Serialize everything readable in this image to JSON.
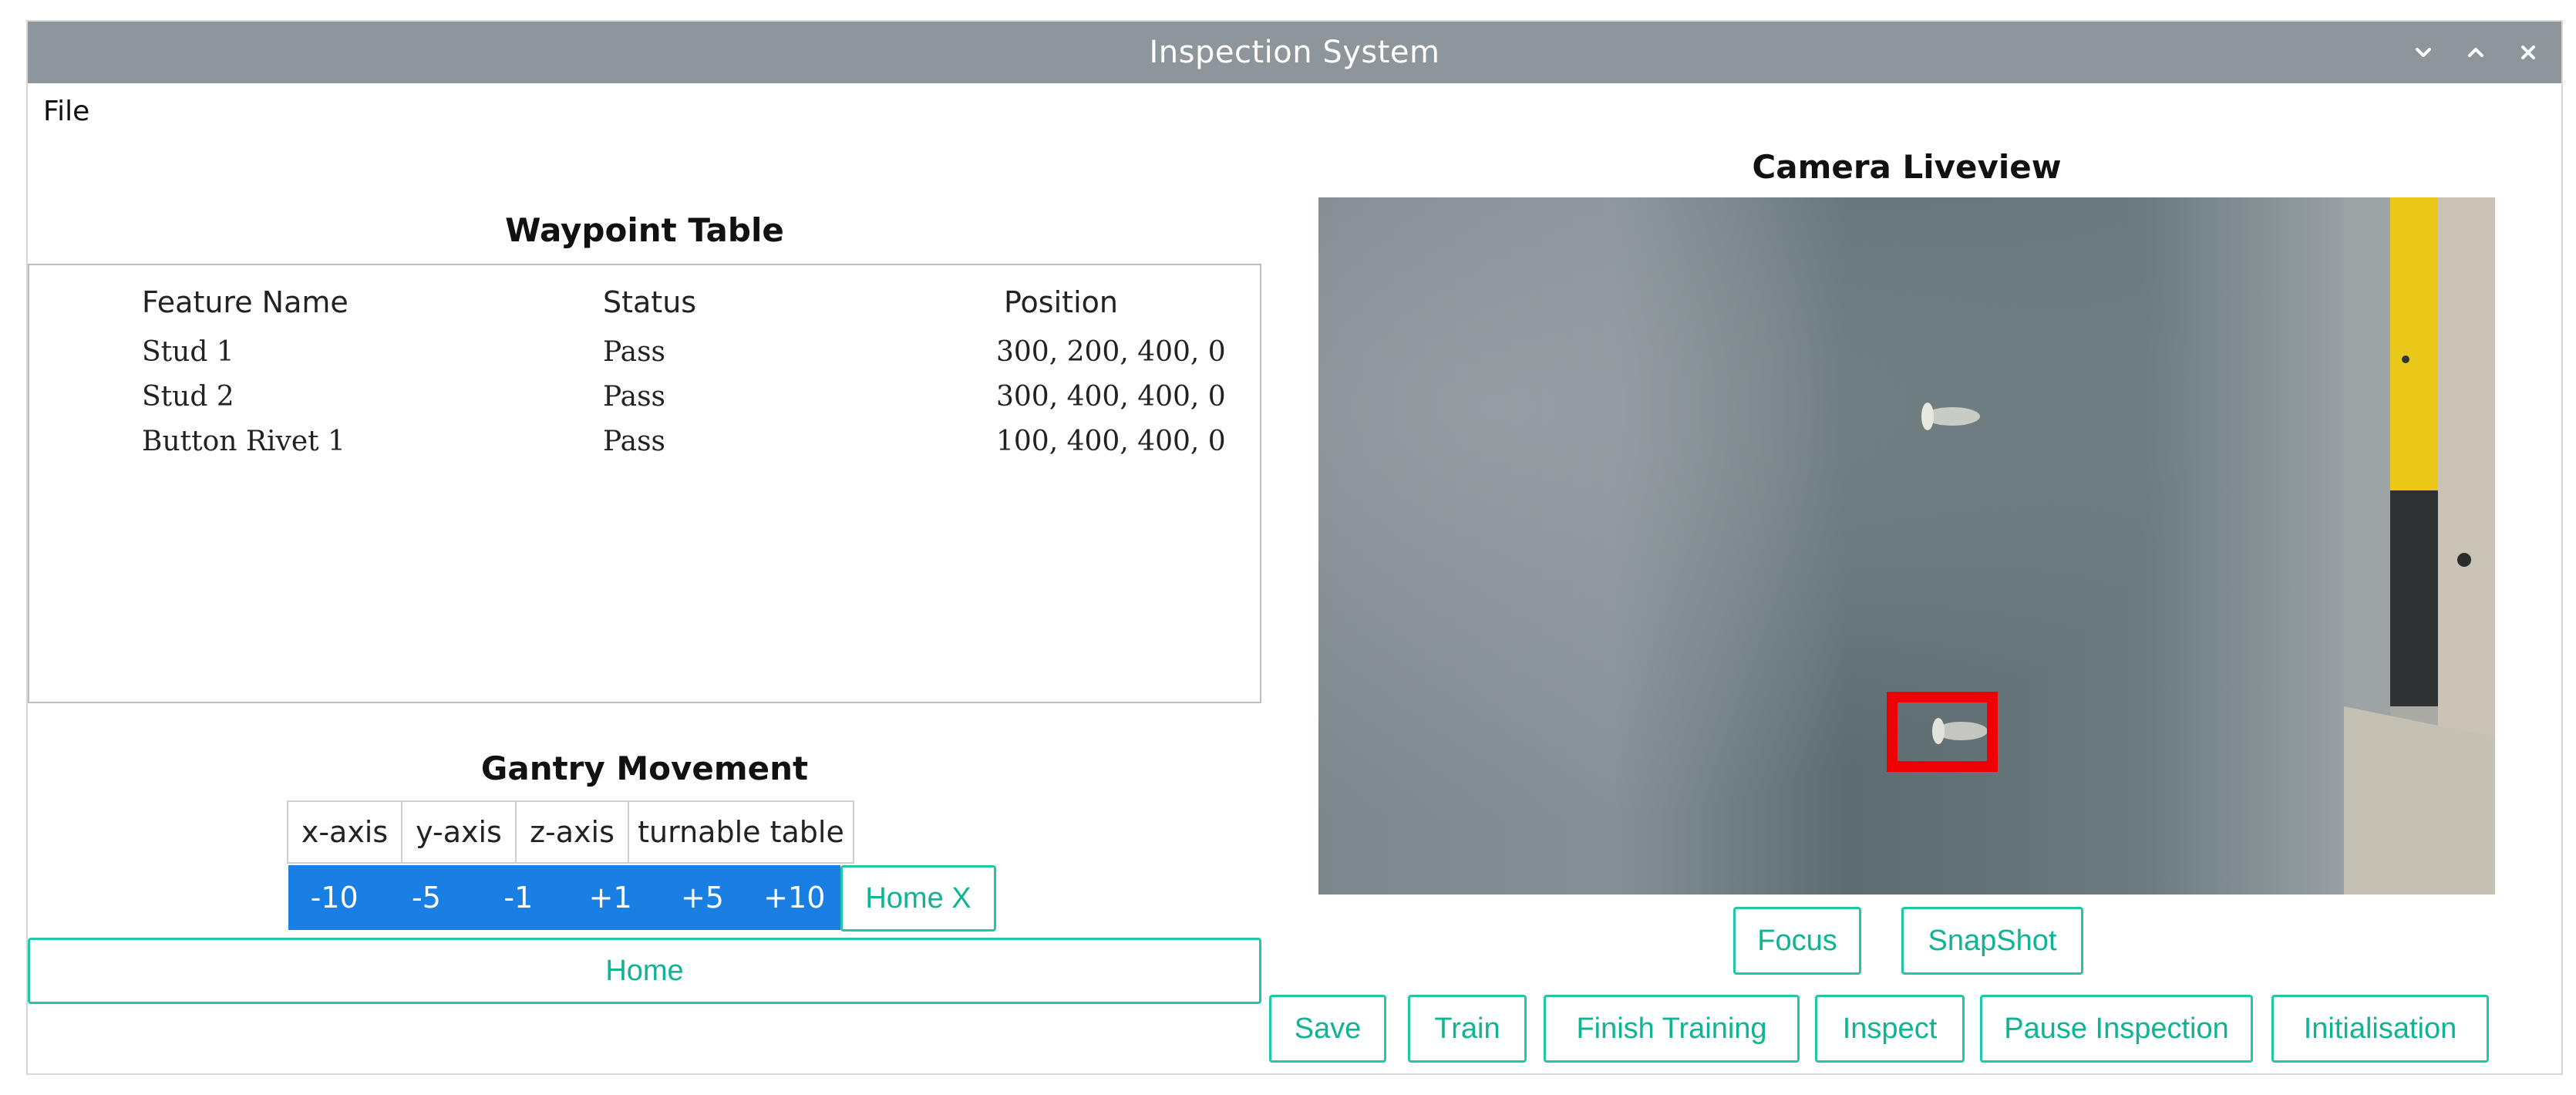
{
  "window": {
    "title": "Inspection System",
    "controls": [
      "minimize-icon",
      "maximize-icon",
      "close-icon"
    ]
  },
  "menu": {
    "file": "File"
  },
  "waypoint_table": {
    "title": "Waypoint Table",
    "columns": [
      "Feature Name",
      "Status",
      "Position"
    ],
    "rows": [
      {
        "feature": "Stud 1",
        "status": "Pass",
        "position": "300, 200, 400, 0"
      },
      {
        "feature": "Stud 2",
        "status": "Pass",
        "position": "300, 400, 400, 0"
      },
      {
        "feature": "Button Rivet 1",
        "status": "Pass",
        "position": "100, 400, 400, 0"
      }
    ]
  },
  "gantry": {
    "title": "Gantry Movement",
    "axes": [
      "x-axis",
      "y-axis",
      "z-axis",
      "turnable table"
    ],
    "steps": [
      "-10",
      "-5",
      "-1",
      "+1",
      "+5",
      "+10"
    ],
    "home_axis": "Home X",
    "home": "Home"
  },
  "camera": {
    "title": "Camera Liveview",
    "focus": "Focus",
    "snapshot": "SnapShot"
  },
  "actions": [
    "Save",
    "Train",
    "Finish Training",
    "Inspect",
    "Pause Inspection",
    "Initialisation"
  ],
  "colors": {
    "titlebar": "#8f969b",
    "accent_teal": "#22c7a8",
    "step_blue": "#1a7fe3",
    "detection_box": "#ee0000"
  }
}
